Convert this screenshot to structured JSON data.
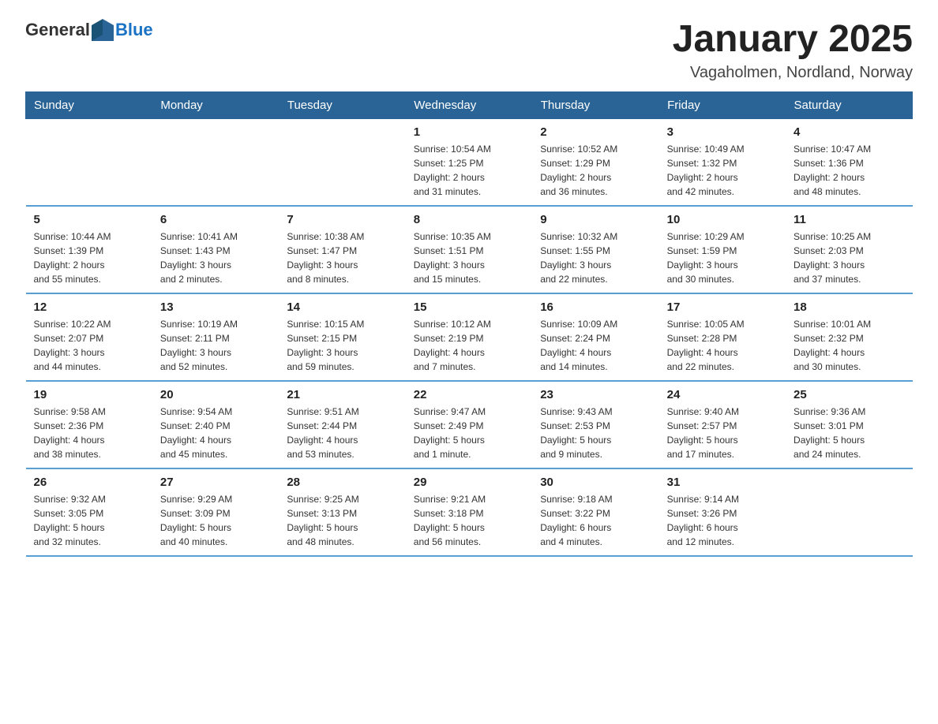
{
  "logo": {
    "general": "General",
    "blue": "Blue"
  },
  "title": "January 2025",
  "location": "Vagaholmen, Nordland, Norway",
  "days_of_week": [
    "Sunday",
    "Monday",
    "Tuesday",
    "Wednesday",
    "Thursday",
    "Friday",
    "Saturday"
  ],
  "weeks": [
    [
      {
        "day": "",
        "info": ""
      },
      {
        "day": "",
        "info": ""
      },
      {
        "day": "",
        "info": ""
      },
      {
        "day": "1",
        "info": "Sunrise: 10:54 AM\nSunset: 1:25 PM\nDaylight: 2 hours\nand 31 minutes."
      },
      {
        "day": "2",
        "info": "Sunrise: 10:52 AM\nSunset: 1:29 PM\nDaylight: 2 hours\nand 36 minutes."
      },
      {
        "day": "3",
        "info": "Sunrise: 10:49 AM\nSunset: 1:32 PM\nDaylight: 2 hours\nand 42 minutes."
      },
      {
        "day": "4",
        "info": "Sunrise: 10:47 AM\nSunset: 1:36 PM\nDaylight: 2 hours\nand 48 minutes."
      }
    ],
    [
      {
        "day": "5",
        "info": "Sunrise: 10:44 AM\nSunset: 1:39 PM\nDaylight: 2 hours\nand 55 minutes."
      },
      {
        "day": "6",
        "info": "Sunrise: 10:41 AM\nSunset: 1:43 PM\nDaylight: 3 hours\nand 2 minutes."
      },
      {
        "day": "7",
        "info": "Sunrise: 10:38 AM\nSunset: 1:47 PM\nDaylight: 3 hours\nand 8 minutes."
      },
      {
        "day": "8",
        "info": "Sunrise: 10:35 AM\nSunset: 1:51 PM\nDaylight: 3 hours\nand 15 minutes."
      },
      {
        "day": "9",
        "info": "Sunrise: 10:32 AM\nSunset: 1:55 PM\nDaylight: 3 hours\nand 22 minutes."
      },
      {
        "day": "10",
        "info": "Sunrise: 10:29 AM\nSunset: 1:59 PM\nDaylight: 3 hours\nand 30 minutes."
      },
      {
        "day": "11",
        "info": "Sunrise: 10:25 AM\nSunset: 2:03 PM\nDaylight: 3 hours\nand 37 minutes."
      }
    ],
    [
      {
        "day": "12",
        "info": "Sunrise: 10:22 AM\nSunset: 2:07 PM\nDaylight: 3 hours\nand 44 minutes."
      },
      {
        "day": "13",
        "info": "Sunrise: 10:19 AM\nSunset: 2:11 PM\nDaylight: 3 hours\nand 52 minutes."
      },
      {
        "day": "14",
        "info": "Sunrise: 10:15 AM\nSunset: 2:15 PM\nDaylight: 3 hours\nand 59 minutes."
      },
      {
        "day": "15",
        "info": "Sunrise: 10:12 AM\nSunset: 2:19 PM\nDaylight: 4 hours\nand 7 minutes."
      },
      {
        "day": "16",
        "info": "Sunrise: 10:09 AM\nSunset: 2:24 PM\nDaylight: 4 hours\nand 14 minutes."
      },
      {
        "day": "17",
        "info": "Sunrise: 10:05 AM\nSunset: 2:28 PM\nDaylight: 4 hours\nand 22 minutes."
      },
      {
        "day": "18",
        "info": "Sunrise: 10:01 AM\nSunset: 2:32 PM\nDaylight: 4 hours\nand 30 minutes."
      }
    ],
    [
      {
        "day": "19",
        "info": "Sunrise: 9:58 AM\nSunset: 2:36 PM\nDaylight: 4 hours\nand 38 minutes."
      },
      {
        "day": "20",
        "info": "Sunrise: 9:54 AM\nSunset: 2:40 PM\nDaylight: 4 hours\nand 45 minutes."
      },
      {
        "day": "21",
        "info": "Sunrise: 9:51 AM\nSunset: 2:44 PM\nDaylight: 4 hours\nand 53 minutes."
      },
      {
        "day": "22",
        "info": "Sunrise: 9:47 AM\nSunset: 2:49 PM\nDaylight: 5 hours\nand 1 minute."
      },
      {
        "day": "23",
        "info": "Sunrise: 9:43 AM\nSunset: 2:53 PM\nDaylight: 5 hours\nand 9 minutes."
      },
      {
        "day": "24",
        "info": "Sunrise: 9:40 AM\nSunset: 2:57 PM\nDaylight: 5 hours\nand 17 minutes."
      },
      {
        "day": "25",
        "info": "Sunrise: 9:36 AM\nSunset: 3:01 PM\nDaylight: 5 hours\nand 24 minutes."
      }
    ],
    [
      {
        "day": "26",
        "info": "Sunrise: 9:32 AM\nSunset: 3:05 PM\nDaylight: 5 hours\nand 32 minutes."
      },
      {
        "day": "27",
        "info": "Sunrise: 9:29 AM\nSunset: 3:09 PM\nDaylight: 5 hours\nand 40 minutes."
      },
      {
        "day": "28",
        "info": "Sunrise: 9:25 AM\nSunset: 3:13 PM\nDaylight: 5 hours\nand 48 minutes."
      },
      {
        "day": "29",
        "info": "Sunrise: 9:21 AM\nSunset: 3:18 PM\nDaylight: 5 hours\nand 56 minutes."
      },
      {
        "day": "30",
        "info": "Sunrise: 9:18 AM\nSunset: 3:22 PM\nDaylight: 6 hours\nand 4 minutes."
      },
      {
        "day": "31",
        "info": "Sunrise: 9:14 AM\nSunset: 3:26 PM\nDaylight: 6 hours\nand 12 minutes."
      },
      {
        "day": "",
        "info": ""
      }
    ]
  ],
  "colors": {
    "header_bg": "#2a6496",
    "header_text": "#ffffff",
    "border": "#5a9fd4"
  }
}
